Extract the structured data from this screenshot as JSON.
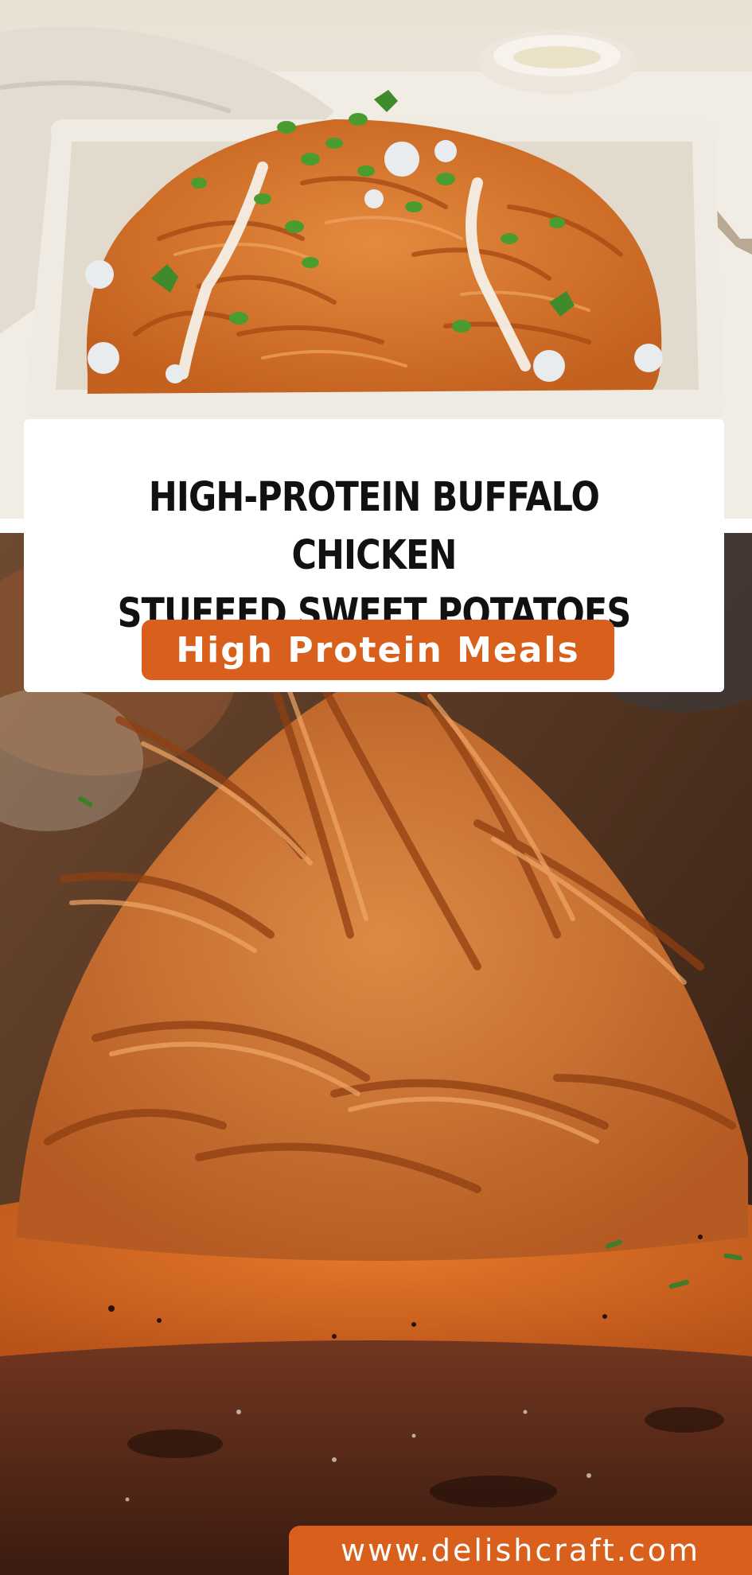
{
  "pin": {
    "title": "HIGH-PROTEIN BUFFALO CHICKEN\nSTUFFED SWEET POTATOES",
    "category": "High Protein Meals",
    "website": "www.delishcraft.com"
  },
  "images": {
    "top": "buffalo-chicken-sweet-potato-casserole-photo",
    "bottom": "shredded-buffalo-chicken-on-sweet-potato-photo"
  },
  "colors": {
    "accent": "#d9601c",
    "title": "#111111",
    "card": "#ffffff"
  }
}
